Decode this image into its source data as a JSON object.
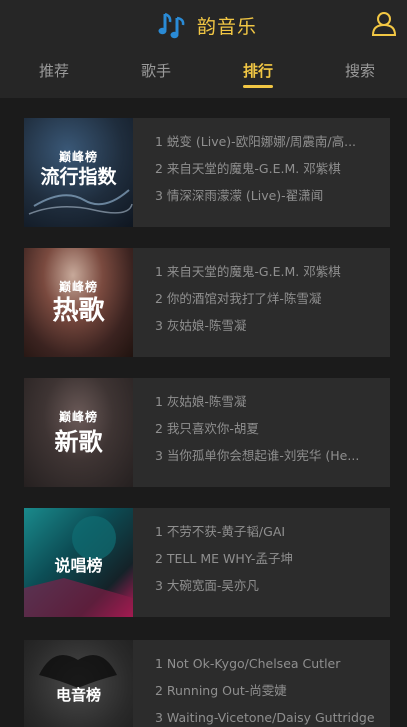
{
  "header": {
    "app_title": "韵音乐",
    "logo_icon": "music-note-icon",
    "user_icon": "user-icon",
    "accent_color": "#f2c744"
  },
  "tabs": [
    {
      "label": "推荐",
      "active": false
    },
    {
      "label": "歌手",
      "active": false
    },
    {
      "label": "排行",
      "active": true
    },
    {
      "label": "搜索",
      "active": false
    }
  ],
  "charts": [
    {
      "cover_brand": "巅峰榜",
      "cover_title": "流行指数",
      "songs": [
        "1 蜕变 (Live)-欧阳娜娜/周震南/高...",
        "2 来自天堂的魔鬼-G.E.M. 邓紫棋",
        "3 情深深雨濛濛 (Live)-翟潇闻"
      ]
    },
    {
      "cover_brand": "巅峰榜",
      "cover_title": "热歌",
      "songs": [
        "1 来自天堂的魔鬼-G.E.M. 邓紫棋",
        "2 你的酒馆对我打了烊-陈雪凝",
        "3 灰姑娘-陈雪凝"
      ]
    },
    {
      "cover_brand": "巅峰榜",
      "cover_title": "新歌",
      "songs": [
        "1 灰姑娘-陈雪凝",
        "2 我只喜欢你-胡夏",
        "3 当你孤单你会想起谁-刘宪华 (He..."
      ]
    },
    {
      "cover_brand": "",
      "cover_title": "说唱榜",
      "songs": [
        "1 不劳不获-黄子韬/GAI",
        "2 TELL ME WHY-孟子坤",
        "3 大碗宽面-吴亦凡"
      ]
    },
    {
      "cover_brand": "",
      "cover_title": "电音榜",
      "songs": [
        "1 Not Ok-Kygo/Chelsea Cutler",
        "2 Running Out-尚雯婕",
        "3 Waiting-Vicetone/Daisy Guttridge"
      ]
    }
  ]
}
